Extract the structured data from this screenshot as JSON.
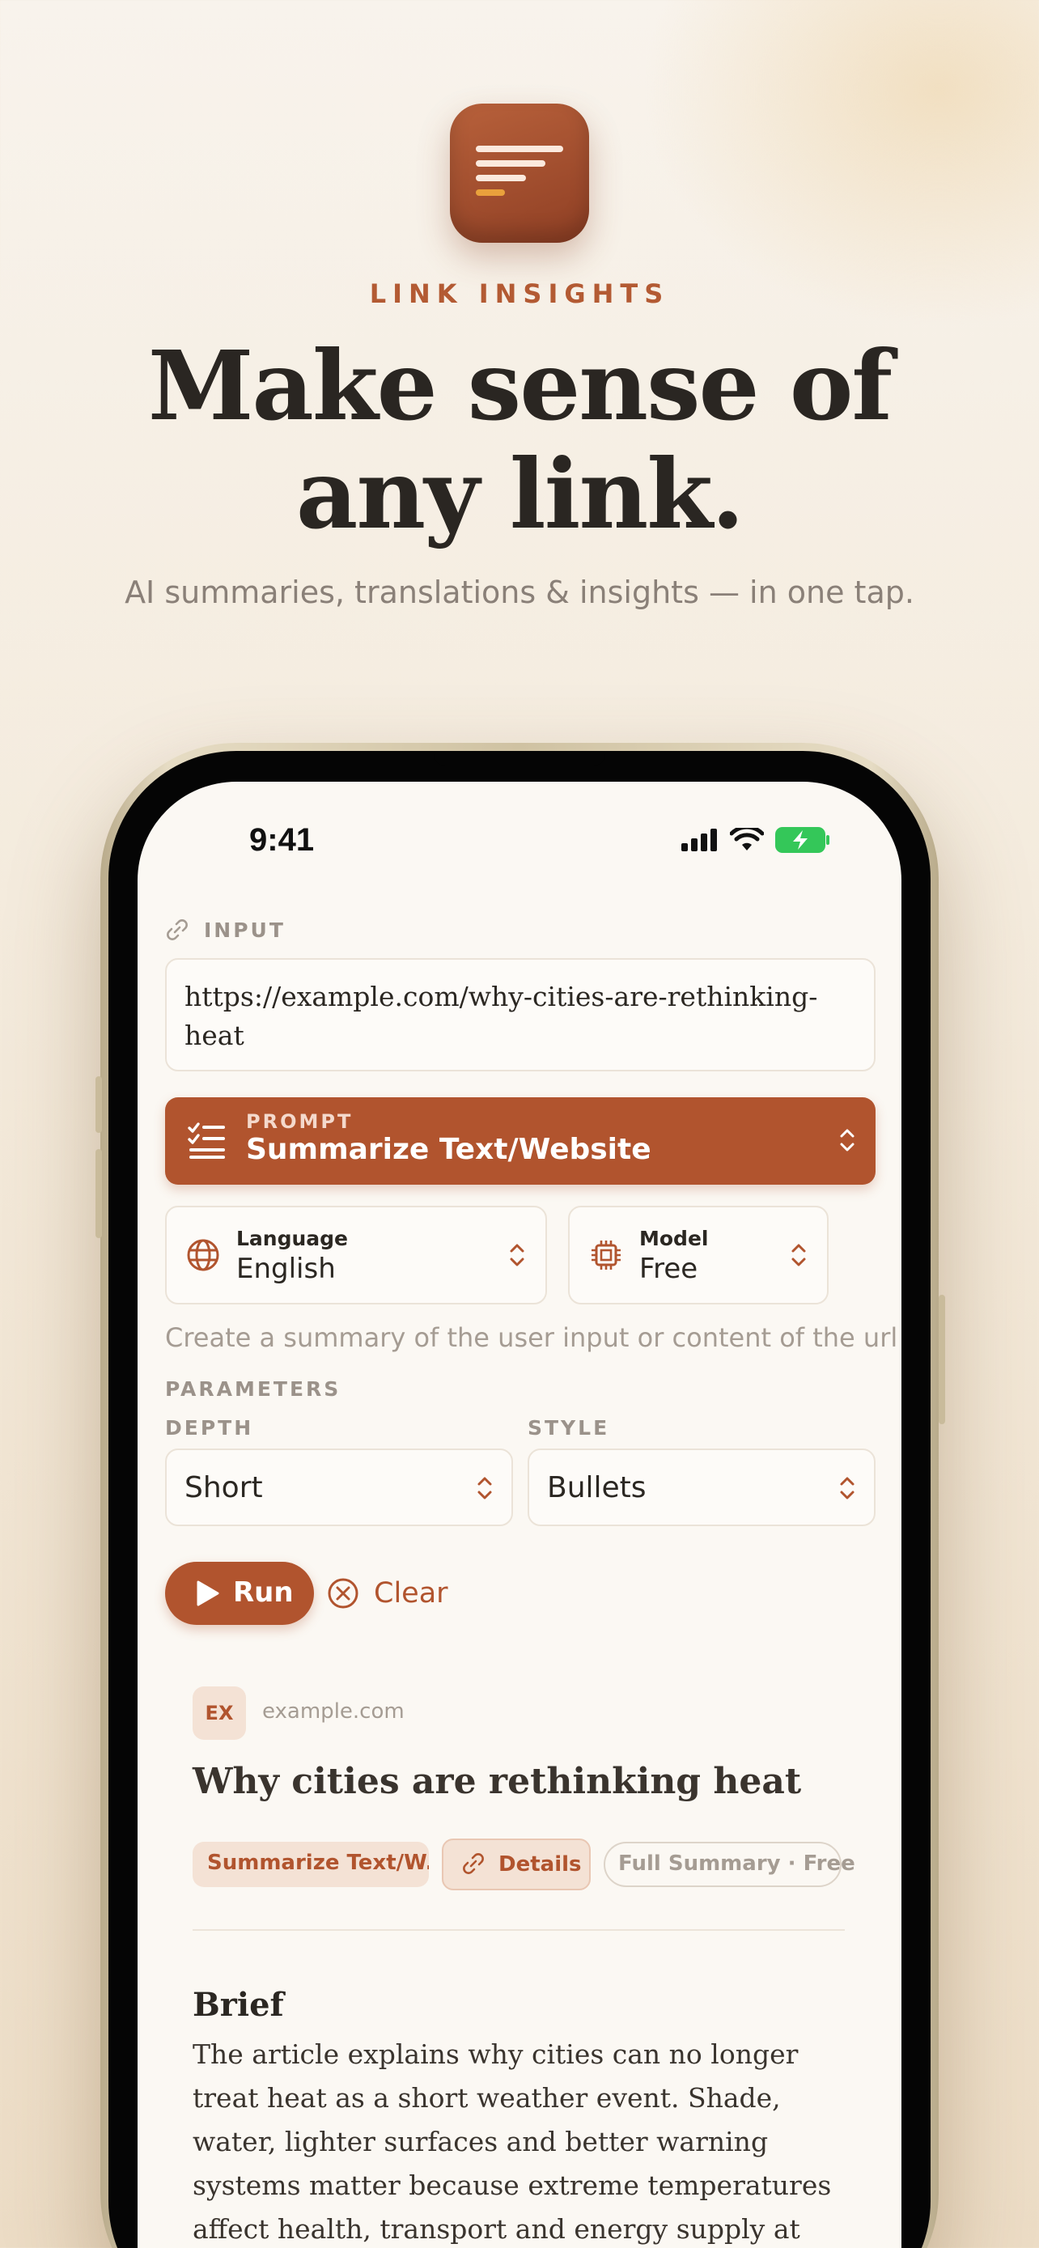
{
  "brand": "LINK INSIGHTS",
  "headline": {
    "line1": "Make sense of",
    "line2": "any link."
  },
  "subtitle": "AI summaries, translations & insights — in one tap.",
  "status_bar": {
    "time": "9:41"
  },
  "input": {
    "label": "INPUT",
    "url": "https://example.com/why-cities-are-rethinking-heat"
  },
  "prompt": {
    "label": "PROMPT",
    "value": "Summarize Text/Website"
  },
  "language": {
    "title": "Language",
    "value": "English"
  },
  "model": {
    "title": "Model",
    "value": "Free"
  },
  "description": "Create a summary of the user input or content of the url",
  "parameters": {
    "heading": "PARAMETERS",
    "depth": {
      "label": "DEPTH",
      "value": "Short"
    },
    "style": {
      "label": "STYLE",
      "value": "Bullets"
    }
  },
  "actions": {
    "run": "Run",
    "clear": "Clear"
  },
  "result": {
    "source_badge": "EX",
    "domain": "example.com",
    "title": "Why cities are rethinking heat",
    "tags": {
      "prompt": "Summarize Text/W...",
      "details": "Details",
      "summary": "Full Summary · Free"
    },
    "brief_heading": "Brief",
    "brief_body": "The article explains why cities can no longer treat heat as a short weather event. Shade, water, lighter surfaces and better warning systems matter because extreme temperatures affect health, transport and energy supply at"
  },
  "colors": {
    "accent": "#b1542e",
    "background": "#fbf8f3",
    "brand": "#b35a33"
  },
  "icons": [
    "app-icon",
    "link-icon",
    "list-icon",
    "chevron-updown-icon",
    "globe-icon",
    "chip-icon",
    "play-icon",
    "close-circle-icon",
    "signal-icon",
    "wifi-icon",
    "battery-icon"
  ]
}
